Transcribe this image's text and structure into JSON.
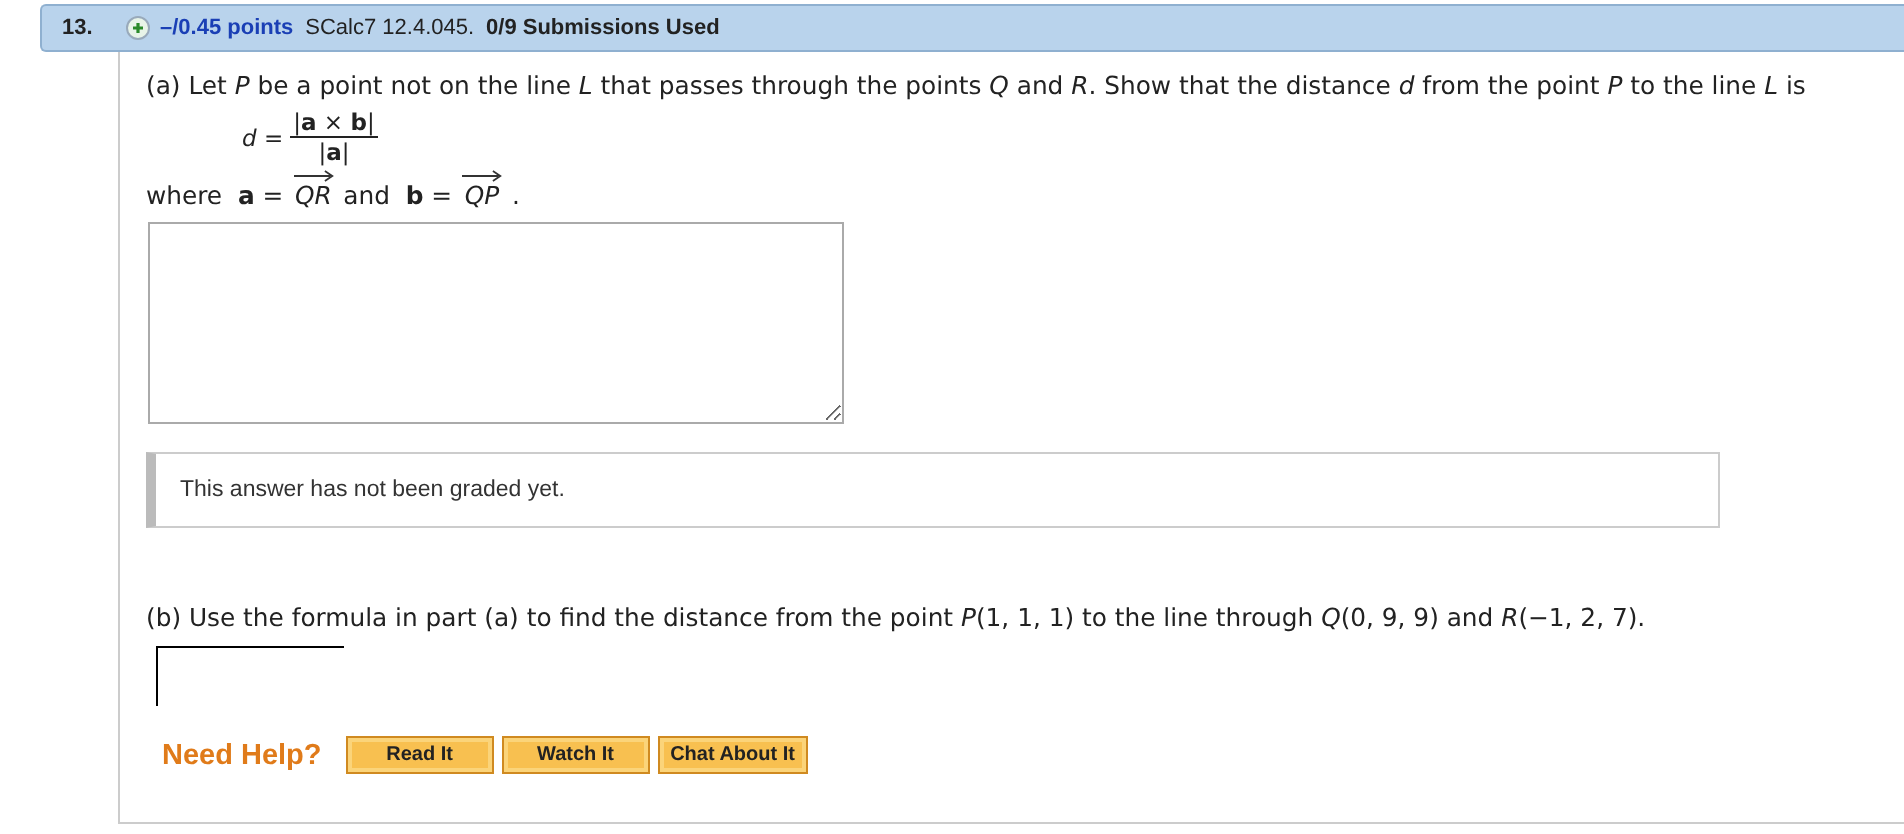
{
  "question": {
    "number": "13.",
    "points": "–/0.45 points",
    "source": "SCalc7 12.4.045.",
    "submissions": "0/9 Submissions Used"
  },
  "part_a": {
    "statement": "(a) Let *P* be a point not on the line *L* that passes through the points *Q* and *R*. Show that the distance *d* from the point *P* to the line *L* is",
    "formula": {
      "lhs": "*d* =",
      "numerator": "|**a** × **b**|",
      "denominator": "|**a**|"
    },
    "where": [
      {
        "kind": "text",
        "text": "where  **a** ="
      },
      {
        "kind": "vector",
        "text": "QR"
      },
      {
        "kind": "text",
        "text": "and  **b** ="
      },
      {
        "kind": "vector",
        "text": "QP"
      },
      {
        "kind": "text",
        "text": "."
      }
    ],
    "feedback": "This answer has not been graded yet."
  },
  "part_b": {
    "statement": "(b) Use the formula in part (a) to find the distance from the point *P*(1, 1, 1) to the line through  *Q*(0, 9, 9)  and  *R*(−1, 2, 7)."
  },
  "help": {
    "label": "Need Help?",
    "buttons": [
      "Read It",
      "Watch It",
      "Chat About It"
    ]
  }
}
